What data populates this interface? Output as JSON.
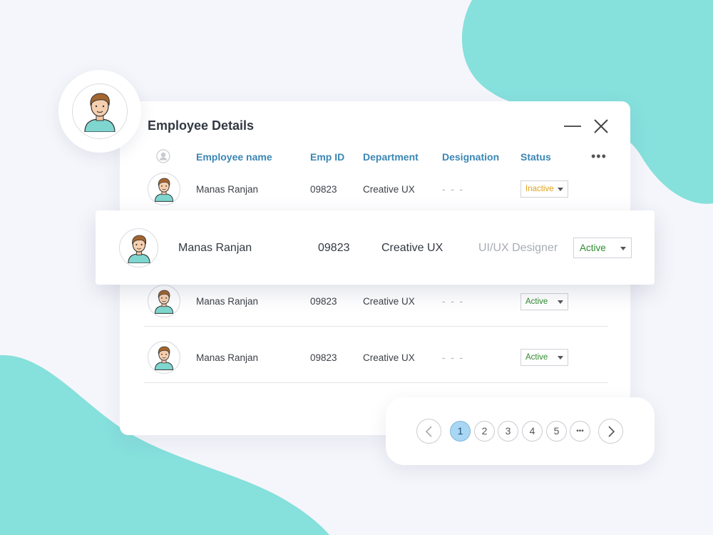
{
  "window": {
    "title": "Employee Details"
  },
  "table": {
    "headers": {
      "name": "Employee name",
      "emp_id": "Emp ID",
      "department": "Department",
      "designation": "Designation",
      "status": "Status"
    },
    "rows": [
      {
        "name": "Manas Ranjan",
        "emp_id": "09823",
        "department": "Creative UX",
        "designation": "- - -",
        "status": "Inactive"
      },
      {
        "name": "Manas Ranjan",
        "emp_id": "09823",
        "department": "Creative UX",
        "designation": "UI/UX Designer",
        "status": "Active"
      },
      {
        "name": "Manas Ranjan",
        "emp_id": "09823",
        "department": "Creative UX",
        "designation": "- - -",
        "status": "Active"
      },
      {
        "name": "Manas Ranjan",
        "emp_id": "09823",
        "department": "Creative UX",
        "designation": "- - -",
        "status": "Active"
      }
    ]
  },
  "pagination": {
    "pages": [
      "1",
      "2",
      "3",
      "4",
      "5"
    ],
    "ellipsis": "•••",
    "current": "1",
    "prev_icon": "chevron-left-icon",
    "next_icon": "chevron-right-icon"
  },
  "colors": {
    "accent_teal": "#86e0dc",
    "header_blue": "#3a86b4",
    "status_active": "#2e8b2e",
    "status_inactive": "#e0a21a",
    "page_active": "#a9d7f3"
  }
}
